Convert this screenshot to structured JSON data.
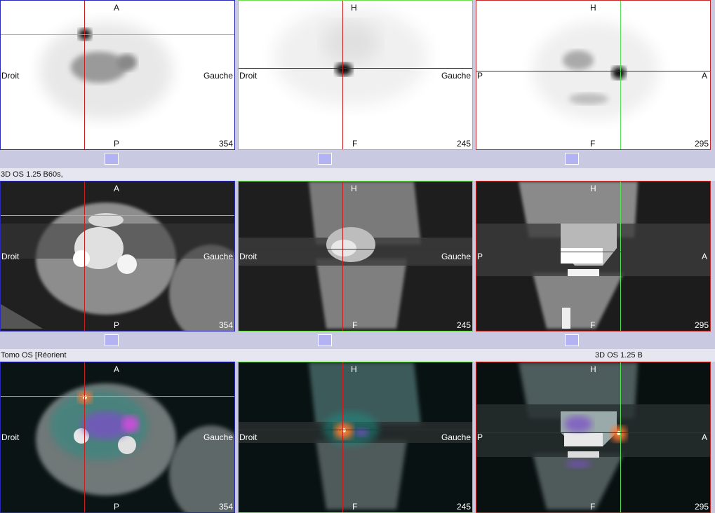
{
  "colors": {
    "axial_border": "#2a2ab8",
    "coronal_border": "#6ce04a",
    "sagittal_border": "#c82a2a",
    "crosshair_red": "#c81e1e",
    "crosshair_green": "#55e055",
    "crosshair_blue": "#2020d0",
    "slider_handle": "#b3b3f3",
    "strip_bg": "#c9c9e2"
  },
  "rows": [
    {
      "name": "spect",
      "series_label": "",
      "series_label_right": "",
      "panels": [
        {
          "top": "A",
          "bottom": "P",
          "left": "Droit",
          "right": "Gauche",
          "slice": "354"
        },
        {
          "top": "H",
          "bottom": "F",
          "left": "Droit",
          "right": "Gauche",
          "slice": "245"
        },
        {
          "top": "H",
          "bottom": "F",
          "left": "P",
          "right": "A",
          "slice": "295"
        }
      ]
    },
    {
      "name": "ct",
      "series_label": "3D OS  1.25  B60s,",
      "series_label_right": "",
      "panels": [
        {
          "top": "A",
          "bottom": "P",
          "left": "Droit",
          "right": "Gauche",
          "slice": "354"
        },
        {
          "top": "H",
          "bottom": "F",
          "left": "Droit",
          "right": "Gauche",
          "slice": "245"
        },
        {
          "top": "H",
          "bottom": "F",
          "left": "P",
          "right": "A",
          "slice": "295"
        }
      ]
    },
    {
      "name": "fusion",
      "series_label": "Tomo OS [Réorient",
      "series_label_right": "3D OS  1.25  B",
      "panels": [
        {
          "top": "A",
          "bottom": "P",
          "left": "Droit",
          "right": "Gauche",
          "slice": "354"
        },
        {
          "top": "H",
          "bottom": "F",
          "left": "Droit",
          "right": "Gauche",
          "slice": "245"
        },
        {
          "top": "H",
          "bottom": "F",
          "left": "P",
          "right": "A",
          "slice": "295"
        }
      ]
    }
  ]
}
